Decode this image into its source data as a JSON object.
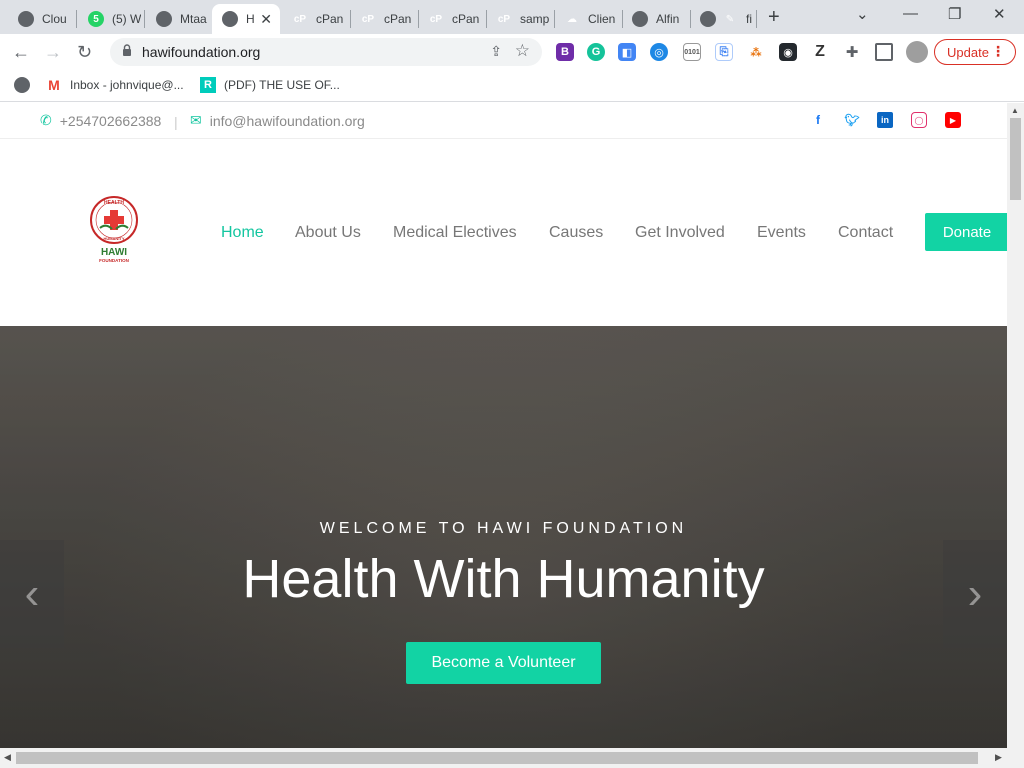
{
  "browser": {
    "tabs": [
      {
        "title": "Clou",
        "icon": "globe-icon",
        "active": false
      },
      {
        "title": "(5) W",
        "icon": "whatsapp-icon",
        "active": false
      },
      {
        "title": "Mtaa",
        "icon": "globe-icon",
        "active": false
      },
      {
        "title": "H",
        "icon": "globe-icon",
        "active": true
      },
      {
        "title": "cPan",
        "icon": "cpanel-icon",
        "active": false
      },
      {
        "title": "cPan",
        "icon": "cpanel-icon",
        "active": false
      },
      {
        "title": "cPan",
        "icon": "cpanel-icon",
        "active": false
      },
      {
        "title": "samp",
        "icon": "cpanel-icon",
        "active": false
      },
      {
        "title": "Clien",
        "icon": "cloud-icon",
        "active": false
      },
      {
        "title": "Alfin",
        "icon": "globe-icon",
        "active": false
      },
      {
        "title": "fi",
        "icon": "pill-icon",
        "active": false
      }
    ],
    "whatsapp_badge": "5",
    "url": "hawifoundation.org",
    "update_label": "Update",
    "bookmarks": [
      {
        "label": "Inbox - johnvique@...",
        "icon": "gmail-icon"
      },
      {
        "label": "(PDF) THE USE OF...",
        "icon": "researchgate-icon"
      }
    ]
  },
  "site": {
    "phone": "+254702662388",
    "email": "info@hawifoundation.org",
    "divider": "|",
    "logo": {
      "line1": "HEALTH",
      "line2": "HUMANITY",
      "name": "HAWI",
      "sub": "FOUNDATION"
    },
    "menu": [
      "Home",
      "About Us",
      "Medical Electives",
      "Causes",
      "Get Involved",
      "Events",
      "Contact"
    ],
    "active_menu": "Home",
    "donate_label": "Donate",
    "hero": {
      "welcome": "WELCOME TO HAWI FOUNDATION",
      "headline": "Health With Humanity",
      "cta": "Become a Volunteer"
    }
  },
  "colors": {
    "accent": "#12d3a4",
    "update_red": "#d93025"
  }
}
